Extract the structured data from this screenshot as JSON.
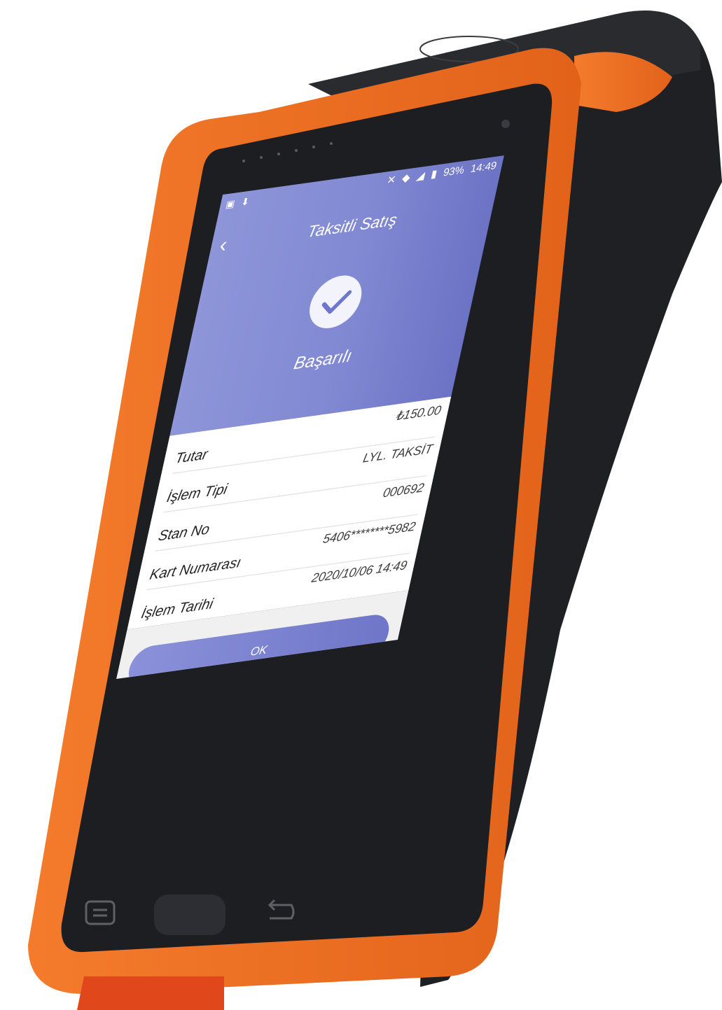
{
  "status_bar": {
    "left_icons": [
      "image-icon",
      "android-icon"
    ],
    "battery": "93%",
    "time": "14:49"
  },
  "header": {
    "back_icon": "chevron-left-icon",
    "title": "Taksitli Satış",
    "status_icon": "check-circle-icon",
    "status_text": "Başarılı"
  },
  "details": [
    {
      "label": "Tutar",
      "value": "₺150.00"
    },
    {
      "label": "İşlem Tipi",
      "value": "LYL. TAKSİT"
    },
    {
      "label": "Stan No",
      "value": "000692"
    },
    {
      "label": "Kart Numarası",
      "value": "5406********5982"
    },
    {
      "label": "İşlem Tarihi",
      "value": "2020/10/06 14:49"
    }
  ],
  "ok_button": "OK",
  "colors": {
    "header": "#8189d3",
    "button": "#7a80ce",
    "device_orange": "#f07a2a",
    "device_black": "#1e1f22"
  }
}
